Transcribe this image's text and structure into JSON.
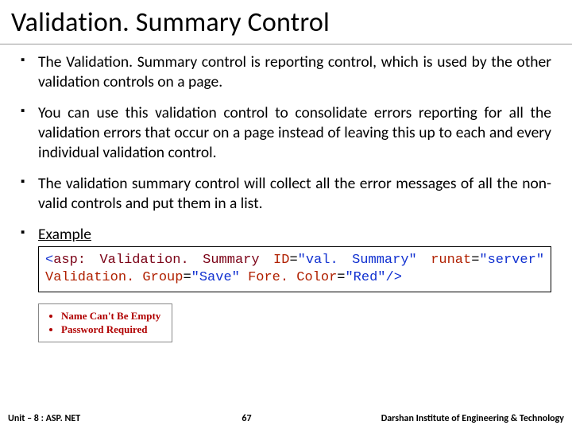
{
  "title": "Validation. Summary Control",
  "bullets": [
    "The Validation. Summary control is reporting control, which is used by the other validation controls on a page.",
    "You can use this validation control to consolidate errors reporting for all the validation errors that occur on a page instead of leaving this up to each and every individual validation control.",
    "The validation summary control will collect all the error messages of all the non-valid controls and put them in a list.",
    "Example"
  ],
  "code": {
    "open1": "<",
    "tag": "asp: Validation. Summary",
    "sp": " ",
    "attr1": "ID",
    "eq": "=",
    "val1": "\"val. Summary\"",
    "attr2": "runat",
    "val2": "\"server\"",
    "attr3": "Validation. Group",
    "val3": "\"Save\"",
    "attr4": "Fore. Color",
    "val4": "\"Red\"",
    "close": "/>"
  },
  "output_items": [
    "Name Can't Be Empty",
    "Password Required"
  ],
  "footer": {
    "unit": "Unit – 8 : ASP. NET",
    "page": "67",
    "inst": "Darshan Institute of Engineering & Technology"
  }
}
